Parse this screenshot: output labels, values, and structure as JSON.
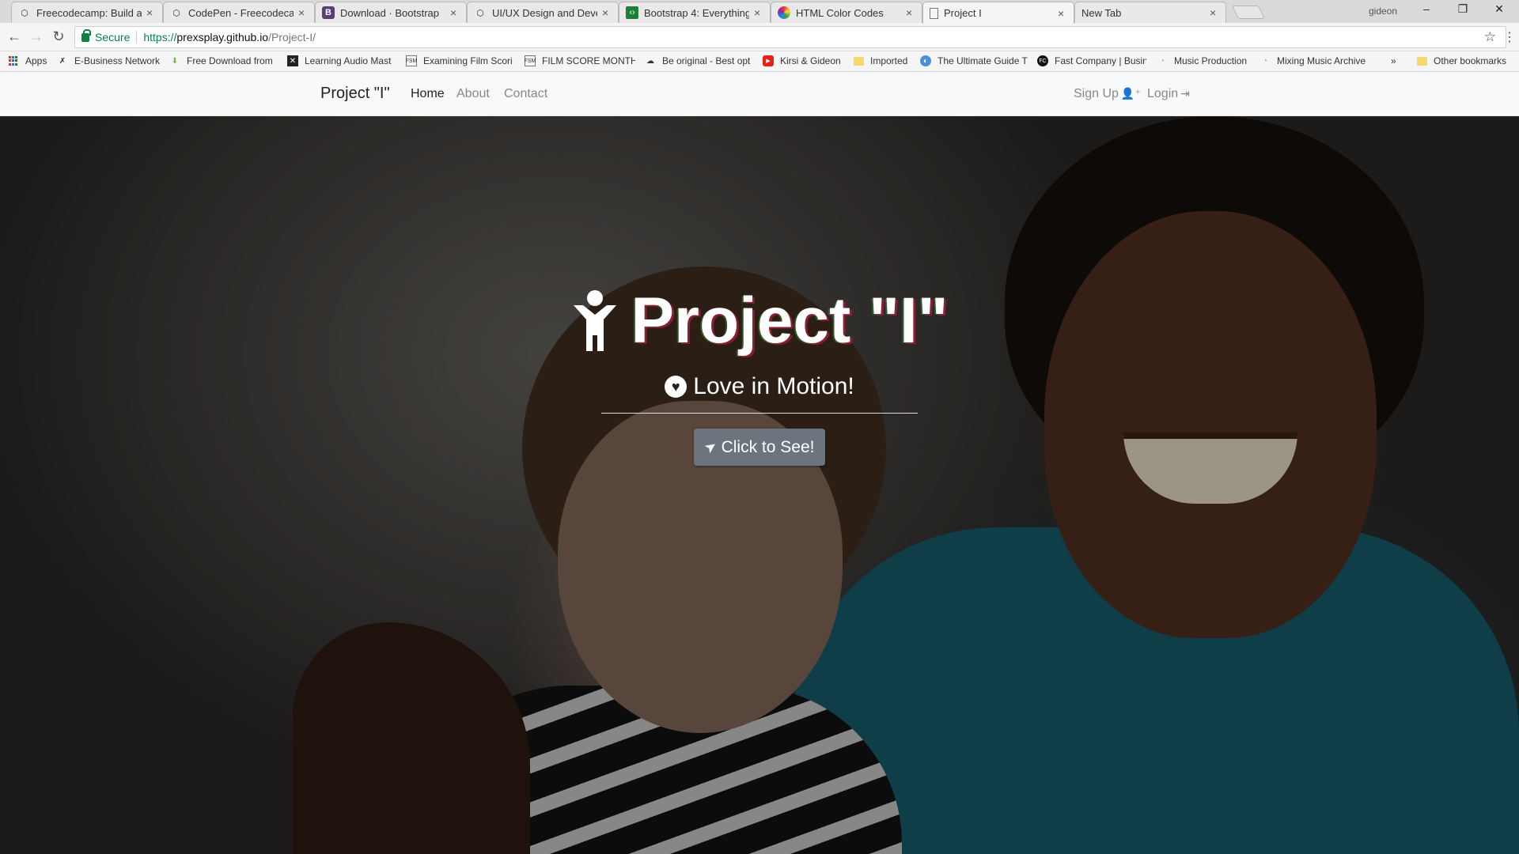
{
  "browser": {
    "tabs": [
      {
        "title": "Freecodecamp: Build a P",
        "favicon": "codepen-icon"
      },
      {
        "title": "CodePen - Freecodecamp",
        "favicon": "codepen-icon"
      },
      {
        "title": "Download · Bootstrap",
        "favicon": "bootstrap-icon"
      },
      {
        "title": "UI/UX Design and Devel",
        "favicon": "codepen-icon"
      },
      {
        "title": "Bootstrap 4: Everything Y",
        "favicon": "code-icon"
      },
      {
        "title": "HTML Color Codes",
        "favicon": "color-wheel-icon"
      },
      {
        "title": "Project I",
        "favicon": "page-icon"
      },
      {
        "title": "New Tab",
        "favicon": ""
      }
    ],
    "profile": "gideon",
    "secure_label": "Secure",
    "url_prefix": "https://",
    "url_host": "prexsplay.github.io",
    "url_path": "/Project-I/",
    "bookmarks": [
      {
        "label": "Apps"
      },
      {
        "label": "E-Business Network"
      },
      {
        "label": "Free Download from"
      },
      {
        "label": "Learning Audio Mast"
      },
      {
        "label": "Examining Film Scori"
      },
      {
        "label": "FILM SCORE MONTH"
      },
      {
        "label": "Be original - Best opt"
      },
      {
        "label": "Kirsi & Gideon"
      },
      {
        "label": "Imported"
      },
      {
        "label": "The Ultimate Guide T"
      },
      {
        "label": "Fast Company | Busin"
      },
      {
        "label": "Music Production"
      },
      {
        "label": "Mixing Music Archive"
      }
    ],
    "more_bookmarks": "»",
    "other_bookmarks": "Other bookmarks"
  },
  "site_nav": {
    "brand": "Project \"I\"",
    "links": [
      "Home",
      "About",
      "Contact"
    ],
    "signup": "Sign Up",
    "login": "Login"
  },
  "hero": {
    "title": "Project \"I\"",
    "subtitle": "Love in Motion!",
    "cta": "Click to See!"
  }
}
